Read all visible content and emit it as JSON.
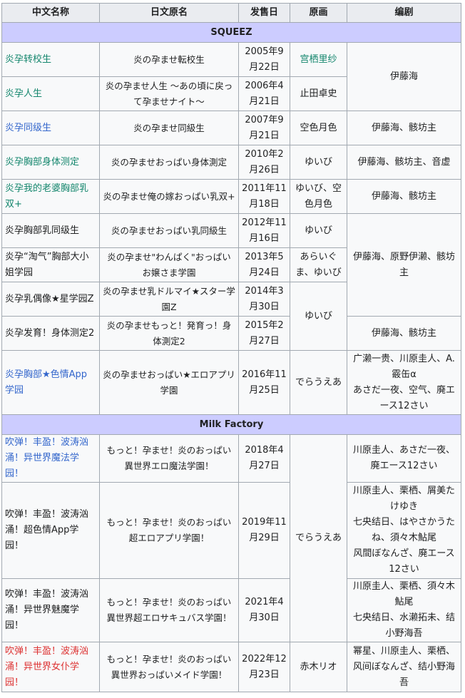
{
  "headers": [
    "中文名称",
    "日文原名",
    "发售日",
    "原画",
    "编剧"
  ],
  "groups": [
    "SQUEEZ",
    "Milk Factory"
  ],
  "rows": [
    {
      "cn": "炎孕转校生",
      "jp": "炎の孕ませ転校生",
      "date": "2005年9月22日",
      "art": "宫栖里纱",
      "writer": "伊藤海"
    },
    {
      "cn": "炎孕人生",
      "jp": "炎の孕ませ人生 ～あの頃に戻って孕ませナイト～",
      "date": "2006年4月21日",
      "art": "止田卓史",
      "writer": ""
    },
    {
      "cn": "炎孕同级生",
      "jp": "炎の孕ませ同級生",
      "date": "2007年9月21日",
      "art": "空色月色",
      "writer": "伊藤海、骸坊主"
    },
    {
      "cn": "炎孕胸部身体测定",
      "jp": "炎の孕ませおっぱい身体測定",
      "date": "2010年2月26日",
      "art": "ゆいび",
      "writer": "伊藤海、骸坊主、音虚"
    },
    {
      "cn": "炎孕我的老婆胸部乳双+",
      "jp": "炎の孕ませ俺の嫁おっぱい乳双+",
      "date": "2011年11月18日",
      "art": "ゆいび、空色月色",
      "writer": "伊藤海、骸坊主"
    },
    {
      "cn": "炎孕胸部乳同级生",
      "jp": "炎の孕ませおっぱい乳同級生",
      "date": "2012年11月16日",
      "art": "ゆいび",
      "writer": "伊藤海、原野伊濑、骸坊主"
    },
    {
      "cn": "炎孕“淘气”胸部大小姐学园",
      "jp": "炎の孕ませ\"わんぱく\"おっぱいお嬢さま学園",
      "date": "2013年5月24日",
      "art": "あらいぐま、ゆいび",
      "writer": ""
    },
    {
      "cn": "炎孕乳偶像★星学园Z",
      "jp": "炎の孕ませ乳ドルマイ★スター学園Z",
      "date": "2014年3月30日",
      "art": "ゆいび",
      "writer": ""
    },
    {
      "cn": "炎孕发育！身体测定2",
      "jp": "炎の孕ませもっと！発育っ！身体測定2",
      "date": "2015年2月27日",
      "art": "",
      "writer": "伊藤海、骸坊主"
    },
    {
      "cn": "炎孕胸部★色情App学园",
      "jp": "炎の孕ませおっぱい★エロアプリ学園",
      "date": "2016年11月25日",
      "art": "でらうえあ",
      "writer": "广濑一贵、川原圭人、A.霰缶α\nあさだ一夜、空气、廃エース12さい"
    },
    {
      "cn": "吹弹！丰盈！波涛汹涌！异世界魔法学园！",
      "jp": "もっと！孕ませ！炎のおっぱい異世界エロ魔法学園！",
      "date": "2018年4月27日",
      "art": "でらうえあ",
      "writer": "川原圭人、あさだ一夜、廃エース12さい"
    },
    {
      "cn": "吹弹！丰盈！波涛汹涌！超色情App学园！",
      "jp": "もっと！孕ませ！炎のおっぱい超エロアプリ学園！",
      "date": "2019年11月29日",
      "art": "",
      "writer": "川原圭人、栗栖、屑美たけゆき\n七央结日、はやさかうたね、須々木鮎尾\n风間ぼなんざ、廃エース12さい"
    },
    {
      "cn": "吹弹！丰盈！波涛汹涌！异世界魅魔学园！",
      "jp": "もっと！孕ませ！炎のおっぱい異世界超エロサキュバス学園！",
      "date": "2021年4月30日",
      "art": "",
      "writer": "川原圭人、栗栖、須々木鮎尾\n七央结日、水濑拓未、结小野海吾"
    },
    {
      "cn": "吹弹！丰盈！波涛汹涌！异世界女仆学园！",
      "jp": "もっと！孕ませ！炎のおっぱい異世界おっぱいメイド学園！",
      "date": "2022年12月23日",
      "art": "赤木リオ",
      "writer": "幂星、川原圭人、栗栖、风间ぼなんざ、结小野海吾"
    }
  ]
}
